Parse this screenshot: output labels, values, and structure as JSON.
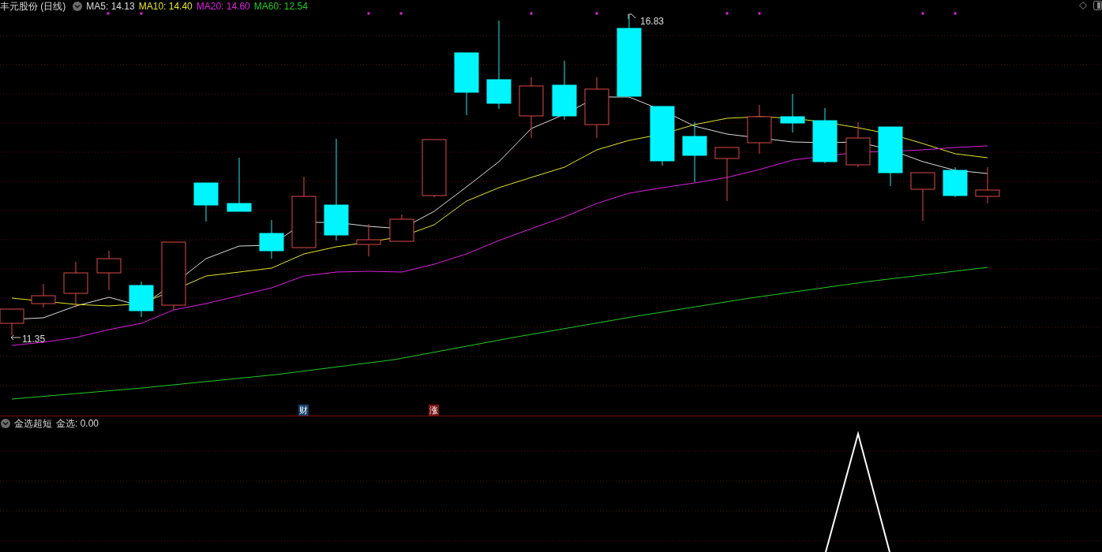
{
  "chart": {
    "title": "丰元股份 (日线)",
    "indicators": [
      {
        "label": "MA5: 14.13",
        "color": "#dcdcdc"
      },
      {
        "label": "MA10: 14.40",
        "color": "#e6e62a"
      },
      {
        "label": "MA20: 14.60",
        "color": "#e020e0"
      },
      {
        "label": "MA60: 12.54",
        "color": "#22cc22"
      }
    ],
    "high_label": "16.83",
    "low_label": "11.35",
    "markers": [
      {
        "text": "财",
        "color": "#17416b"
      },
      {
        "text": "涨",
        "color": "#7a1414"
      }
    ]
  },
  "sub_panel": {
    "title": "金选超短",
    "reading": "金选: 0.00"
  }
}
